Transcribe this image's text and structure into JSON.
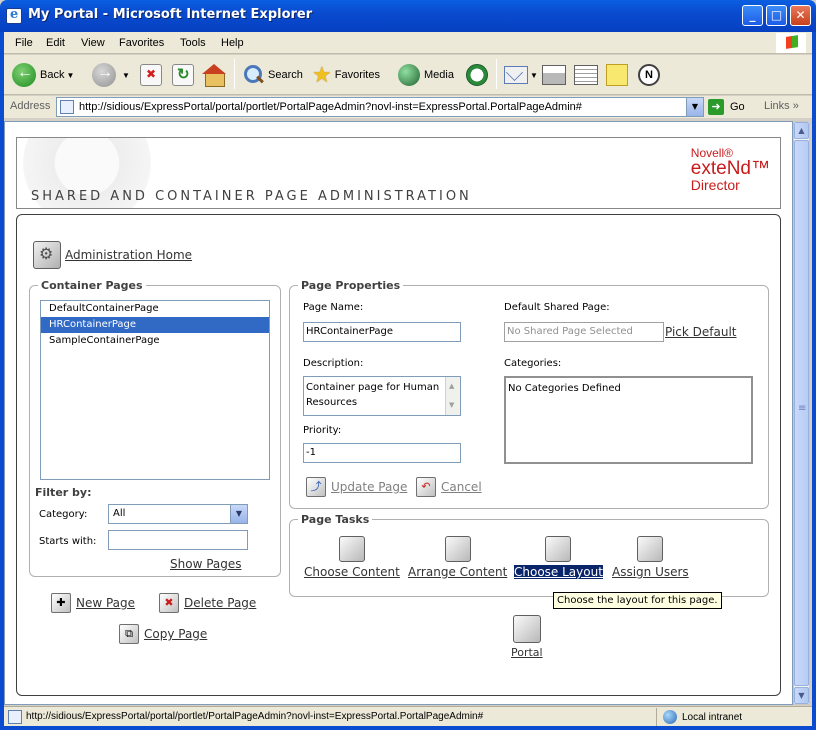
{
  "window": {
    "title": "My Portal - Microsoft Internet Explorer",
    "minimize": "_",
    "maximize": "□",
    "close": "✕"
  },
  "menu": [
    "File",
    "Edit",
    "View",
    "Favorites",
    "Tools",
    "Help"
  ],
  "toolbar": {
    "back": "Back",
    "search": "Search",
    "favorites": "Favorites",
    "media": "Media"
  },
  "address": {
    "label": "Address",
    "url": "http://sidious/ExpressPortal/portal/portlet/PortalPageAdmin?novl-inst=ExpressPortal.PortalPageAdmin#",
    "go": "Go",
    "links": "Links"
  },
  "banner": {
    "heading": "SHARED AND CONTAINER PAGE ADMINISTRATION",
    "logo_novell": "Novell®",
    "logo_extend": "exteNd™",
    "logo_director": "Director"
  },
  "admin_home": "Administration Home",
  "container_pages": {
    "legend": "Container Pages",
    "items": [
      "DefaultContainerPage",
      "HRContainerPage",
      "SampleContainerPage"
    ],
    "selected_index": 1
  },
  "filter": {
    "legend": "Filter by:",
    "category_label": "Category:",
    "category_value": "All",
    "starts_with_label": "Starts with:",
    "starts_with_value": "",
    "show_pages": "Show Pages"
  },
  "page_actions": {
    "new_page": "New Page",
    "delete_page": "Delete Page",
    "copy_page": "Copy Page"
  },
  "page_properties": {
    "legend": "Page Properties",
    "page_name_label": "Page Name:",
    "page_name_value": "HRContainerPage",
    "default_shared_label": "Default Shared Page:",
    "default_shared_value": "No Shared Page Selected",
    "pick_default": "Pick Default",
    "description_label": "Description:",
    "description_value": "Container page for Human Resources",
    "categories_label": "Categories:",
    "categories_value": "No Categories Defined",
    "priority_label": "Priority:",
    "priority_value": "-1",
    "update_page": "Update Page",
    "cancel": "Cancel"
  },
  "page_tasks": {
    "legend": "Page Tasks",
    "choose_content": "Choose Content",
    "arrange_content": "Arrange Content",
    "choose_layout": "Choose Layout",
    "assign_users": "Assign Users"
  },
  "portal": "Portal",
  "tooltip": "Choose the layout for this page.",
  "status": {
    "text": "http://sidious/ExpressPortal/portal/portlet/PortalPageAdmin?novl-inst=ExpressPortal.PortalPageAdmin#",
    "zone": "Local intranet"
  }
}
